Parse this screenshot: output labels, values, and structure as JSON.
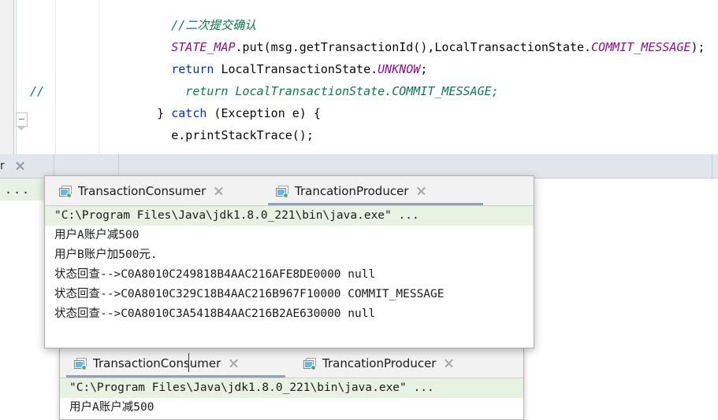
{
  "editor": {
    "lines": [
      {
        "id": "line-comment-confirm",
        "gutter": "",
        "segments": [
          {
            "style": "cmt",
            "text": "        //二次提交确认"
          }
        ]
      },
      {
        "id": "line-state-map-put",
        "gutter": "",
        "segments": [
          {
            "style": "field",
            "text": "        STATE_MAP"
          },
          {
            "style": "plain",
            "text": ".put(msg.getTransactionId(),LocalTransactionState."
          },
          {
            "style": "stat",
            "text": "COMMIT_MESSAGE"
          },
          {
            "style": "plain",
            "text": ");"
          }
        ]
      },
      {
        "id": "line-return-unknow",
        "gutter": "",
        "segments": [
          {
            "style": "kw",
            "text": "        return"
          },
          {
            "style": "plain",
            "text": " LocalTransactionState."
          },
          {
            "style": "stat",
            "text": "UNKNOW"
          },
          {
            "style": "plain",
            "text": ";"
          }
        ]
      },
      {
        "id": "line-commented-return",
        "gutter": "//",
        "segments": [
          {
            "style": "cmt",
            "text": "          return LocalTransactionState.COMMIT_MESSAGE;"
          }
        ]
      },
      {
        "id": "line-catch",
        "gutter": "",
        "segments": [
          {
            "style": "plain",
            "text": "      } "
          },
          {
            "style": "kw",
            "text": "catch"
          },
          {
            "style": "plain",
            "text": " (Exception e) {"
          }
        ]
      },
      {
        "id": "line-printstacktrace",
        "gutter": "",
        "segments": [
          {
            "style": "plain",
            "text": "        e.printStackTrace();"
          }
        ]
      }
    ]
  },
  "background_toolwindow": {
    "partial_tab_label": "r",
    "console_overflow": "...",
    "tab_bar_color": "#e2e5ec"
  },
  "panel_upper": {
    "tabs": [
      {
        "label": "TransactionConsumer",
        "selected": false,
        "running": true
      },
      {
        "label": "TrancationProducer",
        "selected": true,
        "running": true
      }
    ],
    "console_lines": [
      {
        "text": "\"C:\\Program Files\\Java\\jdk1.8.0_221\\bin\\java.exe\" ...",
        "highlight": true
      },
      {
        "text": "用户A账户减500",
        "highlight": false
      },
      {
        "text": "用户B账户加500元.",
        "highlight": false
      },
      {
        "text": "状态回查-->C0A8010C249818B4AAC216AFE8DE0000 null",
        "highlight": false
      },
      {
        "text": "状态回查-->C0A8010C329C18B4AAC216B967F10000 COMMIT_MESSAGE",
        "highlight": false
      },
      {
        "text": "状态回查-->C0A8010C3A5418B4AAC216B2AE630000 null",
        "highlight": false
      }
    ]
  },
  "panel_lower": {
    "tabs": [
      {
        "label": "TransactionConsumer",
        "selected": true,
        "running": true
      },
      {
        "label": "TrancationProducer",
        "selected": false,
        "running": true
      }
    ],
    "console_lines": [
      {
        "text": "\"C:\\Program Files\\Java\\jdk1.8.0_221\\bin\\java.exe\" ...",
        "highlight": true
      },
      {
        "text": "用户A账户减500",
        "highlight": false
      }
    ]
  },
  "colors": {
    "keyword": "#0033b3",
    "comment": "#0b7a4b",
    "static_field": "#871094",
    "console_highlight": "#e7f2e3",
    "tab_selected_underline": "#93a1b5",
    "run_indicator_green": "#59a869"
  }
}
